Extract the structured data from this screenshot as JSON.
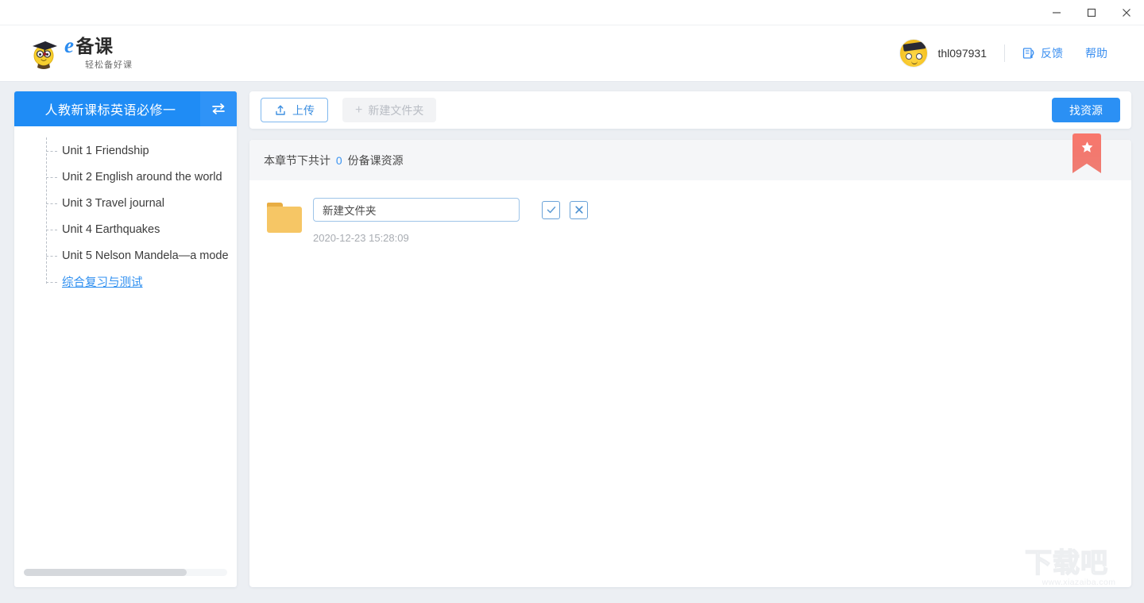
{
  "window": {
    "minimize_label": "−",
    "maximize_label": "□",
    "close_label": "✕"
  },
  "header": {
    "logo_e": "e",
    "logo_main": "备课",
    "logo_sub": "轻松备好课",
    "username": "thl097931",
    "feedback_label": "反馈",
    "help_label": "帮助"
  },
  "sidebar": {
    "title": "人教新课标英语必修一",
    "swap_icon": "swap-icon",
    "items": [
      {
        "label": "Unit 1 Friendship",
        "selected": false
      },
      {
        "label": "Unit 2 English around the world",
        "selected": false
      },
      {
        "label": "Unit 3 Travel journal",
        "selected": false
      },
      {
        "label": "Unit 4 Earthquakes",
        "selected": false
      },
      {
        "label": "Unit 5 Nelson Mandela—a mode",
        "selected": false
      },
      {
        "label": "综合复习与测试",
        "selected": true
      }
    ]
  },
  "toolbar": {
    "upload_label": "上传",
    "new_folder_label": "新建文件夹",
    "new_folder_plus": "+",
    "find_resource_label": "找资源"
  },
  "panel": {
    "summary_prefix": "本章节下共计",
    "summary_count": "0",
    "summary_suffix": "份备课资源",
    "ribbon_icon": "star-bookmark-icon"
  },
  "folder_row": {
    "name_value": "新建文件夹",
    "name_placeholder": "新建文件夹",
    "confirm_icon": "check-icon",
    "cancel_icon": "close-icon",
    "timestamp": "2020-12-23 15:28:09"
  },
  "watermark": {
    "main": "下载吧",
    "sub": "www.xiazaiba.com"
  },
  "colors": {
    "accent_blue": "#2b90f4",
    "sidebar_header": "#1f8cf5",
    "ribbon_red": "#f2796f",
    "folder_yellow": "#f6c665",
    "link_blue": "#3b8ff0"
  }
}
